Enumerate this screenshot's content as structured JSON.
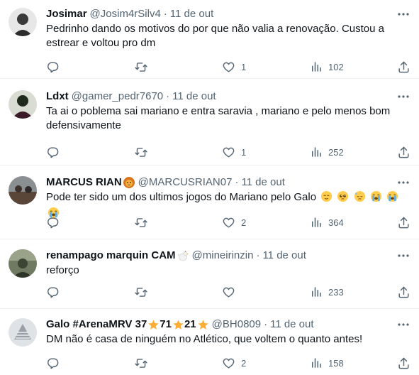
{
  "tweets": [
    {
      "name": "Josimar",
      "handle": "@Josim4rSilv4",
      "separator": "·",
      "date": "11 de out",
      "text_lines": [
        "Pedrinho dando os motivos do por que não valia a renovação. Custou a",
        "estrear e voltou pro dm"
      ],
      "likes": "1",
      "views": "102",
      "avatar_color": "#3a3a3a"
    },
    {
      "name": "Ldxt",
      "handle": "@gamer_pedr7670",
      "separator": "·",
      "date": "11 de out",
      "text_lines": [
        "Ta ai o poblema sai mariano e entra saravia , mariano e pelo menos bom",
        "defensivamente"
      ],
      "likes": "1",
      "views": "252",
      "avatar_color": "#1f2a1c"
    },
    {
      "name": "MARCUS RIAN",
      "handle": "@MARCUSRIAN07",
      "separator": "·",
      "date": "11 de out",
      "text_lines": [
        "Pode ter sido um dos ultimos jogos do Mariano pelo Galo"
      ],
      "likes": "2",
      "views": "364",
      "avatar_color": "#6b5a4a",
      "name_emoji": "lion-face-icon",
      "text_emojis": [
        "relieved-face-icon",
        "pleading-face-icon",
        "downcast-sweat-face-icon",
        "loudly-crying-face-icon",
        "loudly-crying-face-icon",
        "loudly-crying-face-icon"
      ]
    },
    {
      "name": "renampago marquin CAM",
      "handle": "@mineirinzin",
      "separator": "·",
      "date": "11 de out",
      "text_lines": [
        "reforço"
      ],
      "likes": "",
      "views": "233",
      "avatar_color": "#4d5a44",
      "name_emoji": "rooster-icon"
    },
    {
      "name": "Galo #ArenaMRV 37",
      "name_part2": "71",
      "name_part3": "21",
      "handle": "@BH0809",
      "separator": "·",
      "date": "11 de out",
      "text_lines": [
        "DM não é casa de ninguém no Atlético, que voltem o quanto antes!"
      ],
      "likes": "2",
      "views": "158",
      "avatar_color": "#9aa0a6",
      "name_emoji": "star-icon"
    }
  ],
  "colors": {
    "text": "#0f1419",
    "secondary": "#536471",
    "divider": "#eff3f4"
  }
}
